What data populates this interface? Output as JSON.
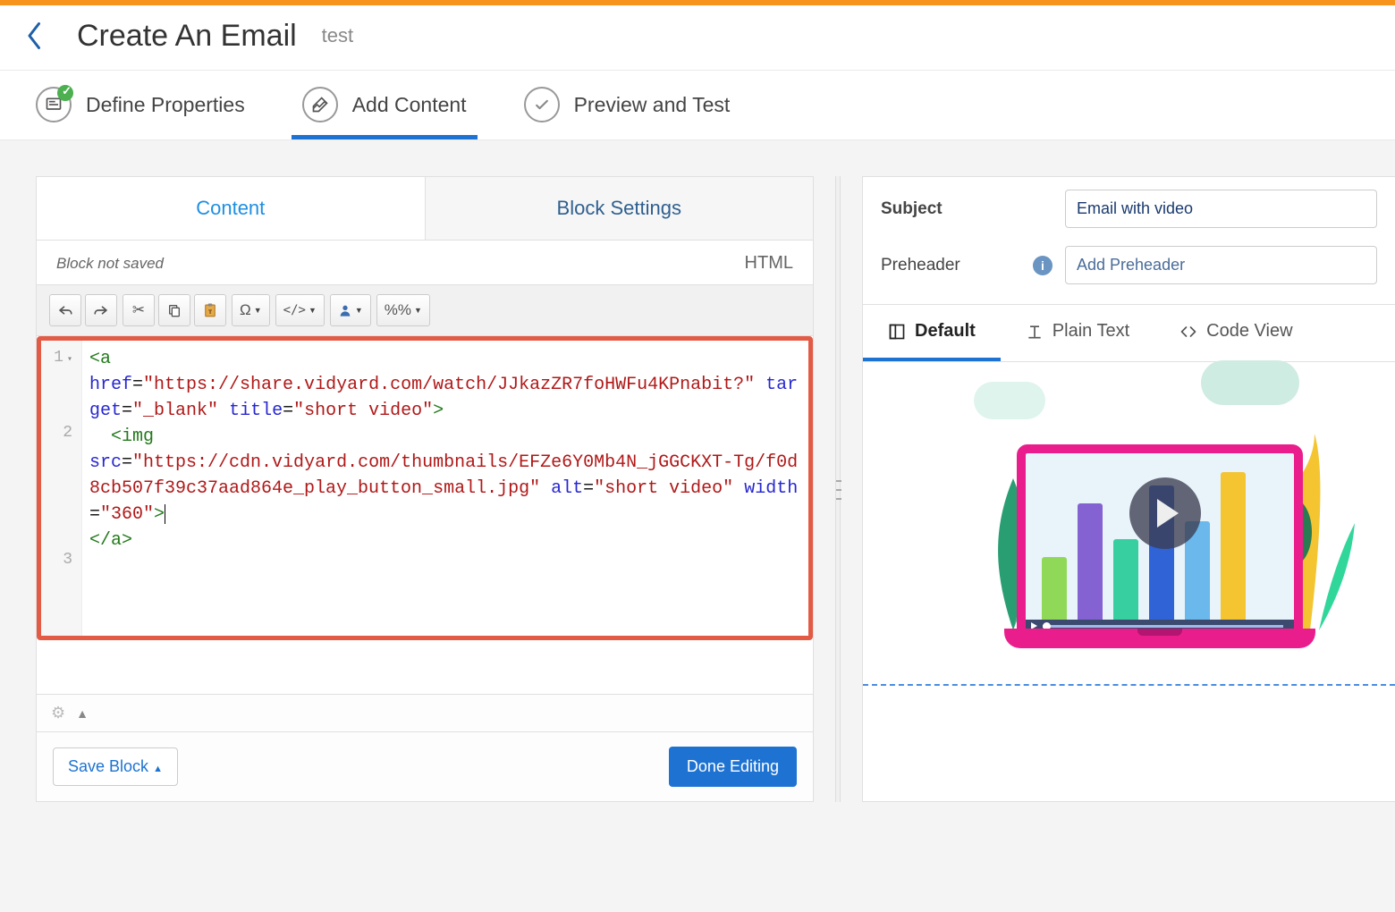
{
  "header": {
    "title": "Create An Email",
    "subtitle": "test"
  },
  "steps": {
    "define": "Define Properties",
    "add": "Add Content",
    "preview": "Preview and Test"
  },
  "panel_tabs": {
    "content": "Content",
    "block_settings": "Block Settings"
  },
  "block_status": "Block not saved",
  "html_badge": "HTML",
  "toolbar": {
    "omega": "Ω",
    "code": "</>",
    "pct": "%%"
  },
  "code": {
    "line1_num": "1",
    "line1_marker": "▾",
    "line2_num": "2",
    "line3_num": "3",
    "tag_a_open": "<a",
    "attr_href": "href",
    "val_href": "\"https://share.vidyard.com/watch/JJkazZR7foHWFu4KPnabit?\"",
    "attr_target": "target",
    "val_target": "\"_blank\"",
    "attr_title": "title",
    "val_title": "\"short video\"",
    "close_angle": ">",
    "tag_img": "<img",
    "attr_src": "src",
    "val_src": "\"https://cdn.vidyard.com/thumbnails/EFZe6Y0Mb4N_jGGCKXT-Tg/f0d8cb507f39c37aad864e_play_button_small.jpg\"",
    "attr_alt": "alt",
    "val_alt": "\"short video\"",
    "attr_width": "width",
    "val_width": "\"360\"",
    "tag_a_close": "</a>",
    "eq": "="
  },
  "footer": {
    "save_block": "Save Block",
    "done_editing": "Done Editing"
  },
  "right": {
    "subject_label": "Subject",
    "subject_value": "Email with video",
    "preheader_label": "Preheader",
    "preheader_placeholder": "Add Preheader"
  },
  "view_tabs": {
    "default": "Default",
    "plain": "Plain Text",
    "code": "Code View"
  }
}
